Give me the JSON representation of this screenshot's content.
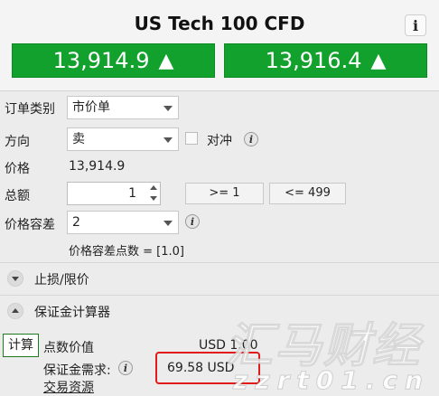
{
  "header": {
    "title": "US Tech 100 CFD",
    "info_label": "i",
    "bid": {
      "price": "13,914.9",
      "arrow": "▲"
    },
    "ask": {
      "price": "13,916.4",
      "arrow": "▲"
    }
  },
  "form": {
    "order_type": {
      "label": "订单类别",
      "value": "市价单"
    },
    "direction": {
      "label": "方向",
      "value": "卖",
      "hedge_label": "对冲"
    },
    "price": {
      "label": "价格",
      "value": "13,914.9"
    },
    "amount": {
      "label": "总额",
      "value": "1",
      "min": ">= 1",
      "max": "<= 499"
    },
    "tolerance": {
      "label": "价格容差",
      "value": "2",
      "points_text": "价格容差点数 = [1.0]"
    }
  },
  "sections": {
    "stop_limit": "止损/限价",
    "margin_calc": "保证金计算器"
  },
  "calculator": {
    "calc_button": "计算",
    "pip_value_label": "点数价值",
    "pip_value": "USD 1.00",
    "margin_label": "保证金需求:",
    "margin_value": "69.58 USD",
    "trading_resources": "交易资源"
  },
  "watermark": {
    "text": "汇马财经",
    "url": "zzrt01.cn"
  },
  "colors": {
    "price_green": "#12a12c",
    "highlight_red": "#e11b1b",
    "watermark_white": "#ffffff"
  }
}
